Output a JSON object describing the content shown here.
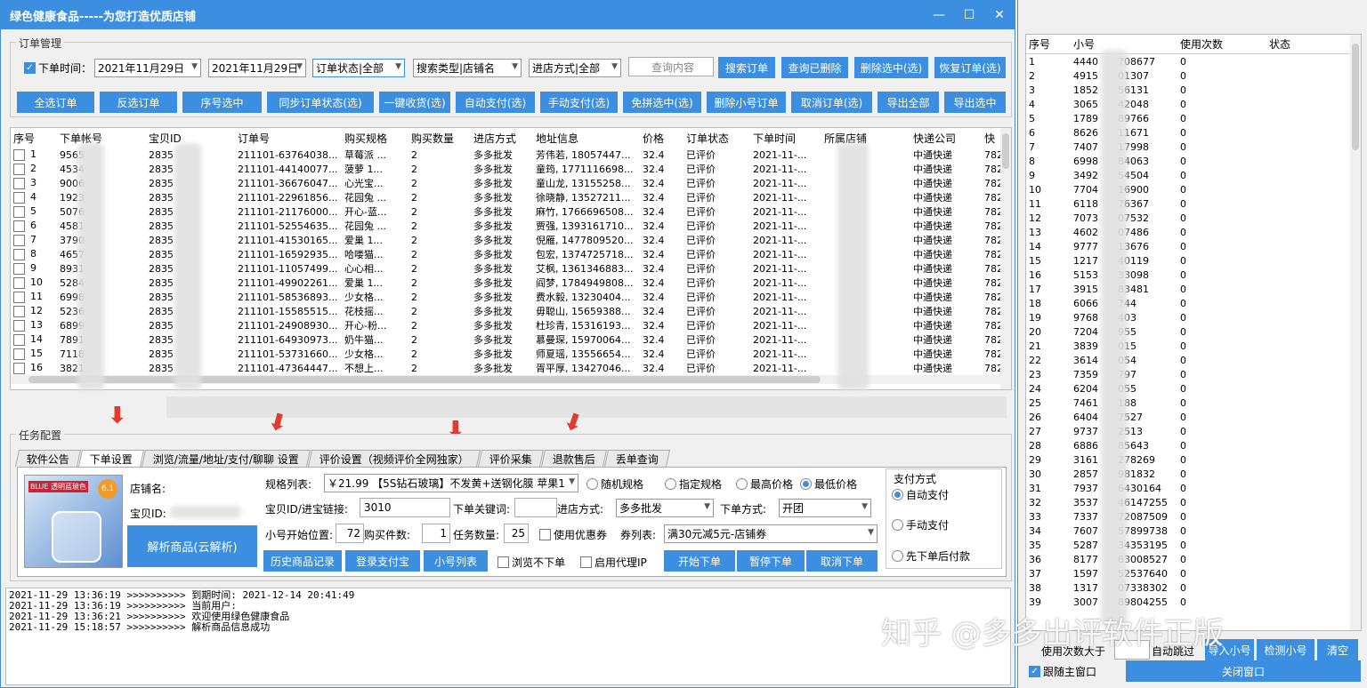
{
  "window": {
    "title": "绿色健康食品-----为您打造优质店铺"
  },
  "order_group": {
    "label": "订单管理",
    "date_label": "下单时间：",
    "date_from": "2021年11月29日",
    "date_to": "2021年11月29日",
    "status_select": "订单状态|全部",
    "search_type_select": "搜索类型|店铺名",
    "stock_select": "进店方式|全部",
    "query_placeholder": "查询内容"
  },
  "top_buttons": [
    "搜索订单",
    "查询已删除",
    "删除选中(选)",
    "恢复订单(选)"
  ],
  "action_buttons": [
    "全选订单",
    "反选订单",
    "序号选中",
    "同步订单状态(选)",
    "一键收货(选)",
    "自动支付(选)",
    "手动支付(选)",
    "免拼选中(选)",
    "删除小号订单",
    "取消订单(选)",
    "导出全部",
    "导出选中"
  ],
  "grid": {
    "columns": [
      "序号",
      "下单帐号",
      "宝贝ID",
      "订单号",
      "购买规格",
      "购买数量",
      "进店方式",
      "地址信息",
      "价格",
      "订单状态",
      "下单时间",
      "所属店铺",
      "快递公司",
      "快"
    ],
    "rows": [
      [
        "1",
        "9565",
        "2835",
        "211101-63764038...",
        "草莓派 ...",
        "2",
        "多多批发",
        "芳伟若, 18057447...",
        "32.4",
        "已评价",
        "2021-11-...",
        "",
        "中通快递",
        "782"
      ],
      [
        "2",
        "4534",
        "2835",
        "211101-44140077...",
        "菠萝 1...",
        "2",
        "多多批发",
        "童筠, 1771116698...",
        "32.4",
        "已评价",
        "2021-11-...",
        "",
        "中通快递",
        "782"
      ],
      [
        "3",
        "9006",
        "2835",
        "211101-36676047...",
        "心光宝...",
        "2",
        "多多批发",
        "童山龙, 13155258...",
        "32.4",
        "已评价",
        "2021-11-...",
        "",
        "中通快递",
        "782"
      ],
      [
        "4",
        "1923",
        "2835",
        "211101-22961856...",
        "花园兔 ...",
        "2",
        "多多批发",
        "徐晓静, 13527211...",
        "32.4",
        "已评价",
        "2021-11-...",
        "",
        "中通快递",
        "782"
      ],
      [
        "5",
        "5076",
        "2835",
        "211101-21176000...",
        "开心-蓝...",
        "2",
        "多多批发",
        "麻竹, 1766696508...",
        "32.4",
        "已评价",
        "2021-11-...",
        "",
        "中通快递",
        "782"
      ],
      [
        "6",
        "4581",
        "2835",
        "211101-52554635...",
        "花园兔 ...",
        "2",
        "多多批发",
        "贾强, 1393161710...",
        "32.4",
        "已评价",
        "2021-11-...",
        "",
        "中通快递",
        "782"
      ],
      [
        "7",
        "3790",
        "2835",
        "211101-41530165...",
        "爱巢 1...",
        "2",
        "多多批发",
        "倪雁, 1477809520...",
        "32.4",
        "已评价",
        "2021-11-...",
        "",
        "中通快递",
        "782"
      ],
      [
        "8",
        "4657",
        "2835",
        "211101-16592935...",
        "哈喽猫...",
        "2",
        "多多批发",
        "包宏, 1374725718...",
        "32.4",
        "已评价",
        "2021-11-...",
        "",
        "中通快递",
        "782"
      ],
      [
        "9",
        "8931",
        "2835",
        "211101-11057499...",
        "心心相...",
        "2",
        "多多批发",
        "艾枫, 1361346883...",
        "32.4",
        "已评价",
        "2021-11-...",
        "",
        "中通快递",
        "782"
      ],
      [
        "10",
        "5284",
        "2835",
        "211101-49902261...",
        "爱巢 1...",
        "2",
        "多多批发",
        "阎梦, 1784949808...",
        "32.4",
        "已评价",
        "2021-11-...",
        "",
        "中通快递",
        "782"
      ],
      [
        "11",
        "6998",
        "2835",
        "211101-58536893...",
        "少女格...",
        "2",
        "多多批发",
        "费水毅, 13230404...",
        "32.4",
        "已评价",
        "2021-11-...",
        "",
        "中通快递",
        "782"
      ],
      [
        "12",
        "5236",
        "2835",
        "211101-15585515...",
        "花枝摇...",
        "2",
        "多多批发",
        "毋聪山, 15659388...",
        "32.4",
        "已评价",
        "2021-11-...",
        "",
        "中通快递",
        "782"
      ],
      [
        "13",
        "6899",
        "2835",
        "211101-24908930...",
        "开心-粉...",
        "2",
        "多多批发",
        "杜珍青, 15316193...",
        "32.4",
        "已评价",
        "2021-11-...",
        "",
        "中通快递",
        "782"
      ],
      [
        "14",
        "7891",
        "2835",
        "211101-64930973...",
        "奶牛猫...",
        "2",
        "多多批发",
        "慕曼琛, 15970064...",
        "32.4",
        "已评价",
        "2021-11-...",
        "",
        "中通快递",
        "782"
      ],
      [
        "15",
        "7118",
        "2835",
        "211101-53731660...",
        "少女格...",
        "2",
        "多多批发",
        "师夏瑶, 13556654...",
        "32.4",
        "已评价",
        "2021-11-...",
        "",
        "中通快递",
        "782"
      ],
      [
        "16",
        "3821",
        "2835",
        "211101-47364447...",
        "不想上...",
        "2",
        "多多批发",
        "胥平厚, 13427046...",
        "32.4",
        "已评价",
        "2021-11-...",
        "",
        "中通快递",
        "782"
      ]
    ]
  },
  "task_group": {
    "label": "任务配置"
  },
  "tabs": [
    "软件公告",
    "下单设置",
    "浏览/流量/地址/支付/聊聊 设置",
    "评价设置（视频评价全网独家）",
    "评价采集",
    "退款售后",
    "丢单查询"
  ],
  "product": {
    "shop_label": "店铺名:",
    "id_label": "宝贝ID:",
    "parse_button": "解析商品(云解析)",
    "image_caption": "BLUE 透明蓝玻色",
    "image_badge": "6.1"
  },
  "form": {
    "spec_label": "规格列表:",
    "spec_value": "￥21.99 【5S钻石玻璃】不发黄+送钢化膜 苹果1",
    "radios": [
      "随机规格",
      "指定规格",
      "最高价格",
      "最低价格"
    ],
    "link_label": "宝贝ID/进宝链接:",
    "link_value": "3010",
    "keyword_label": "下单关键词:",
    "enter_label": "进店方式:",
    "enter_value": "多多批发",
    "order_mode_label": "下单方式:",
    "order_mode_value": "开团",
    "start_label": "小号开始位置:",
    "start_value": "72",
    "qty_label": "购买件数:",
    "qty_value": "1",
    "task_label": "任务数量:",
    "task_value": "25",
    "coupon_label": "使用优惠券",
    "coupon_list_label": "券列表:",
    "coupon_list_value": "满30元减5元-店铺券",
    "browse_label": "浏览不下单",
    "proxy_label": "启用代理IP"
  },
  "bottom_buttons": [
    "历史商品记录",
    "登录支付宝",
    "小号列表"
  ],
  "order_buttons": [
    "开始下单",
    "暂停下单",
    "取消下单"
  ],
  "pay": {
    "label": "支付方式",
    "options": [
      "自动支付",
      "手动支付",
      "先下单后付款"
    ]
  },
  "log": [
    "2021-11-29 13:36:19 >>>>>>>>>> 到期时间: 2021-12-14 20:41:49",
    "2021-11-29 13:36:19 >>>>>>>>>> 当前用户: ",
    "2021-11-29 13:36:21 >>>>>>>>>> 欢迎使用绿色健康食品",
    "2021-11-29 15:18:57 >>>>>>>>>> 解析商品信息成功"
  ],
  "right": {
    "columns": [
      "序号",
      "小号",
      "使用次数",
      "状态"
    ],
    "rows": [
      [
        "1",
        "4440",
        "708677",
        "0"
      ],
      [
        "2",
        "4915",
        "01307",
        "0"
      ],
      [
        "3",
        "1852",
        "56131",
        "0"
      ],
      [
        "4",
        "3065",
        "42048",
        "0"
      ],
      [
        "5",
        "1789",
        "89766",
        "0"
      ],
      [
        "6",
        "8626",
        "11671",
        "0"
      ],
      [
        "7",
        "7407",
        "17998",
        "0"
      ],
      [
        "8",
        "6998",
        "84063",
        "0"
      ],
      [
        "9",
        "3492",
        "54504",
        "0"
      ],
      [
        "10",
        "7704",
        "16900",
        "0"
      ],
      [
        "11",
        "6118",
        "76367",
        "0"
      ],
      [
        "12",
        "7073",
        "07532",
        "0"
      ],
      [
        "13",
        "4602",
        "07486",
        "0"
      ],
      [
        "14",
        "9777",
        "13676",
        "0"
      ],
      [
        "15",
        "1217",
        "40119",
        "0"
      ],
      [
        "16",
        "5153",
        "33098",
        "0"
      ],
      [
        "17",
        "3915",
        "83481",
        "0"
      ],
      [
        "18",
        "6066",
        "744",
        "0"
      ],
      [
        "19",
        "9768",
        "403",
        "0"
      ],
      [
        "20",
        "7204",
        "955",
        "0"
      ],
      [
        "21",
        "3839",
        "015",
        "0"
      ],
      [
        "22",
        "3614",
        "054",
        "0"
      ],
      [
        "23",
        "7359",
        "797",
        "0"
      ],
      [
        "24",
        "6204",
        "055",
        "0"
      ],
      [
        "25",
        "7461",
        "188",
        "0"
      ],
      [
        "26",
        "6404",
        "7527",
        "0"
      ],
      [
        "27",
        "9737",
        "2513",
        "0"
      ],
      [
        "28",
        "6886",
        "85643",
        "0"
      ],
      [
        "29",
        "3161",
        "278269",
        "0"
      ],
      [
        "30",
        "2857",
        "981832",
        "0"
      ],
      [
        "31",
        "7937",
        "6430164",
        "0"
      ],
      [
        "32",
        "3537",
        "46147255",
        "0"
      ],
      [
        "33",
        "7337",
        "72087509",
        "0"
      ],
      [
        "34",
        "7607",
        "57899738",
        "0"
      ],
      [
        "35",
        "5287",
        "34353195",
        "0"
      ],
      [
        "36",
        "8177",
        "63008527",
        "0"
      ],
      [
        "37",
        "1597",
        "52537640",
        "0"
      ],
      [
        "38",
        "1317",
        "07338302",
        "0"
      ],
      [
        "39",
        "3007",
        "89804255",
        "0"
      ]
    ],
    "min_use_label": "使用次数大于",
    "auto_skip": "自动跳过",
    "import_btn": "导入小号",
    "check_btn": "检测小号",
    "clear_btn": "清空",
    "follow_label": "跟随主窗口",
    "close_btn": "关闭窗口"
  },
  "watermark": "知乎 @多多出评软件正版"
}
